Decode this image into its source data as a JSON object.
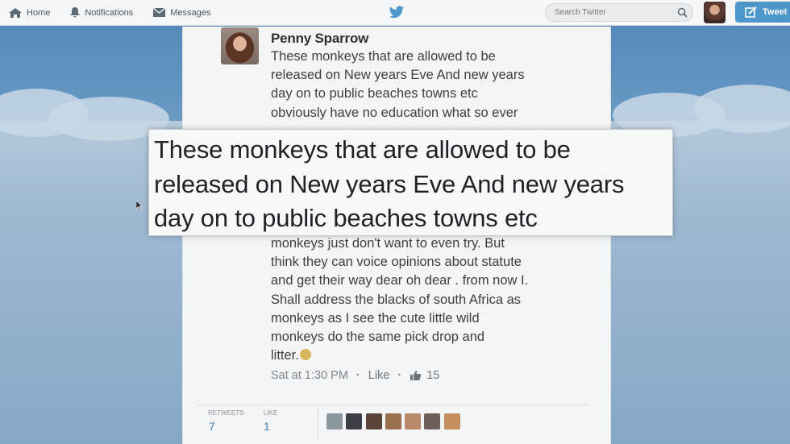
{
  "nav": {
    "home_label": "Home",
    "notifications_label": "Notifications",
    "messages_label": "Messages",
    "search_placeholder": "Search Twitter",
    "tweet_button_label": "Tweet"
  },
  "tweet": {
    "author": "Penny Sparrow",
    "lines_top": [
      "These monkeys that are allowed to be",
      "released on New years Eve And new years",
      "day on to public beaches towns etc",
      "obviously have no education what so ever"
    ],
    "lines_bottom": [
      "monkeys just don't want to even try. But",
      "think they can voice opinions about statute",
      "and get their way dear oh dear . from now I.",
      "Shall address the blacks of south Africa as",
      "monkeys as I see the cute little wild",
      "monkeys do the same pick  drop and",
      "litter."
    ],
    "timestamp": "Sat at 1:30 PM",
    "like_link": "Like",
    "like_count": "15"
  },
  "zoom": {
    "lines": [
      "These monkeys that are allowed to be",
      "released on New years Eve And new years",
      "day on to public beaches towns etc"
    ]
  },
  "stats": {
    "retweets_label": "RETWEETS",
    "retweets_value": "7",
    "likes_label": "LIKE",
    "likes_value": "1"
  },
  "colors": {
    "twitter_blue": "#4d97cd",
    "link_blue": "#3f7fb5",
    "background_sky": "#5f91bf"
  }
}
